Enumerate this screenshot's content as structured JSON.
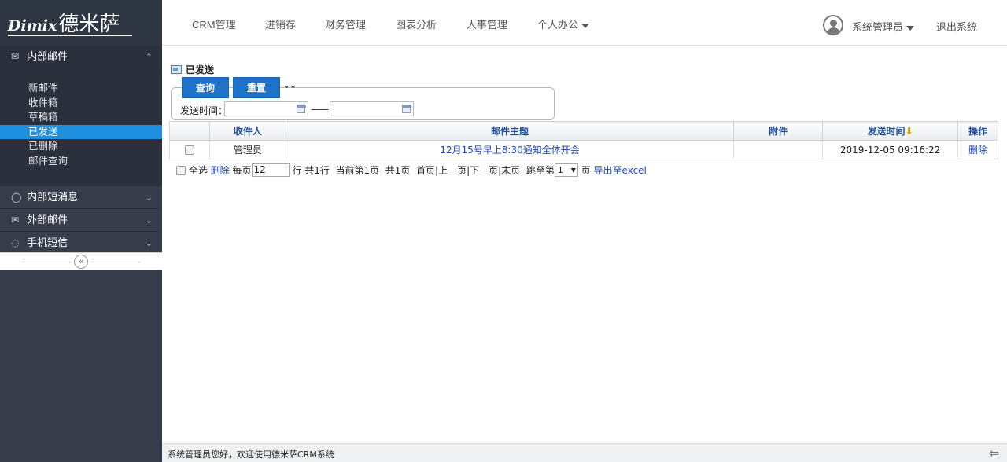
{
  "brand": {
    "latin": "Dimix",
    "cjk": "德米萨"
  },
  "topnav": {
    "items": [
      "CRM管理",
      "进销存",
      "财务管理",
      "图表分析",
      "人事管理",
      "个人办公"
    ],
    "user_name": "系统管理员",
    "logout": "退出系统"
  },
  "sidebar": {
    "groups": [
      {
        "label": "内部邮件",
        "icon": "envelope-outline-icon"
      },
      {
        "label": "内部短消息",
        "icon": "speech-bubble-icon"
      },
      {
        "label": "外部邮件",
        "icon": "envelope-icon"
      },
      {
        "label": "手机短信",
        "icon": "chat-bubbles-icon"
      }
    ],
    "mail_items": [
      "新邮件",
      "收件箱",
      "草稿箱",
      "已发送",
      "已删除",
      "邮件查询"
    ],
    "active_item": "已发送",
    "collapse_icon": "double-chevron-left-icon"
  },
  "page": {
    "title": "已发送",
    "search": {
      "query_label": "查询",
      "reset_label": "重置",
      "date_label": "发送时间：",
      "date_separator": "——",
      "date_from": "",
      "date_to": ""
    },
    "table": {
      "columns": [
        "",
        "收件人",
        "邮件主题",
        "附件",
        "发送时间",
        "操作"
      ],
      "sort_icon": "sort-down-arrow-icon",
      "rows": [
        {
          "recipient": "管理员",
          "subject": "12月15号早上8:30通知全体开会",
          "attachment": "",
          "sent_time": "2019-12-05 09:16:22",
          "action": "删除"
        }
      ]
    },
    "pager": {
      "select_all": "全选",
      "delete": "删除",
      "per_page_prefix": "每页",
      "per_page_value": "12",
      "per_page_suffix": "行",
      "total_rows": "共1行",
      "current_page": "当前第1页",
      "total_pages": "共1页",
      "nav": "首页|上一页|下一页|末页",
      "jump_prefix": "跳至第",
      "jump_value": "1",
      "jump_suffix": "页",
      "export": "导出至excel"
    }
  },
  "footer": {
    "text": "系统管理员您好，欢迎使用德米萨CRM系统"
  },
  "colors": {
    "sidebar_bg": "#363c4a",
    "accent": "#1f8fe0",
    "button": "#1e73c8",
    "link": "#2348c0"
  }
}
